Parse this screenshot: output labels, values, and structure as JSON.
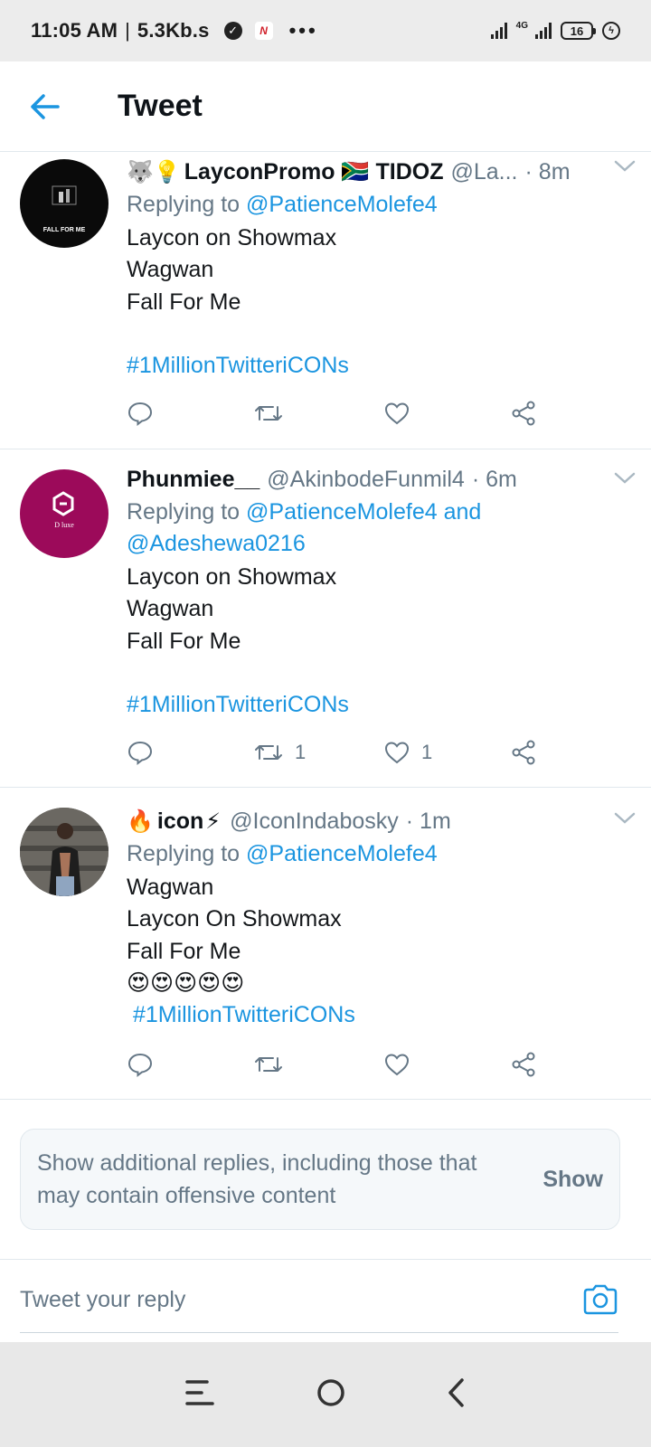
{
  "status_bar": {
    "time": "11:05 AM",
    "speed": "5.3Kb.s",
    "network": "4G",
    "battery": "16"
  },
  "header": {
    "title": "Tweet"
  },
  "tweets": [
    {
      "emoji_prefix": "🐺💡",
      "name": "LayconPromo 🇿🇦 TIDOZ",
      "handle": "@La...",
      "time": "· 8m",
      "replying_label": "Replying to ",
      "replying_to": "@PatienceMolefe4",
      "lines": [
        "Laycon on Showmax",
        "Wagwan",
        "Fall For Me",
        ""
      ],
      "hashtag": "#1MillionTwitteriCONs",
      "retweets": "",
      "likes": "",
      "avatar_text": "FALL FOR ME"
    },
    {
      "name": "Phunmiee__",
      "handle": "@AkinbodeFunmil4",
      "time": "· 6m",
      "replying_label": "Replying to ",
      "replying_to": "@PatienceMolefe4 and @Adeshewa0216",
      "lines": [
        "Laycon on Showmax",
        "Wagwan",
        "Fall For Me",
        ""
      ],
      "hashtag": "#1MillionTwitteriCONs",
      "retweets": "1",
      "likes": "1",
      "avatar_text": "D luxe"
    },
    {
      "emoji_prefix": "🔥",
      "name": "icon",
      "name_suffix": "⚡",
      "handle": "@IconIndabosky",
      "time": "· 1m",
      "replying_label": "Replying to ",
      "replying_to": "@PatienceMolefe4",
      "lines": [
        "Wagwan",
        "Laycon On Showmax",
        "Fall For Me",
        "😍😍😍😍😍"
      ],
      "hashtag": " #1MillionTwitteriCONs",
      "retweets": "",
      "likes": ""
    }
  ],
  "additional_replies": {
    "text": "Show additional replies, including those that may contain offensive content",
    "button": "Show"
  },
  "reply_bar": {
    "placeholder": "Tweet your reply"
  },
  "colors": {
    "link": "#1b95e0",
    "muted": "#657786",
    "avatar2": "#9c0a5a"
  },
  "icons": [
    "back-arrow-icon",
    "reply-icon",
    "retweet-icon",
    "like-icon",
    "share-icon",
    "caret-down-icon",
    "camera-icon",
    "menu-icon",
    "home-icon",
    "back-icon"
  ]
}
